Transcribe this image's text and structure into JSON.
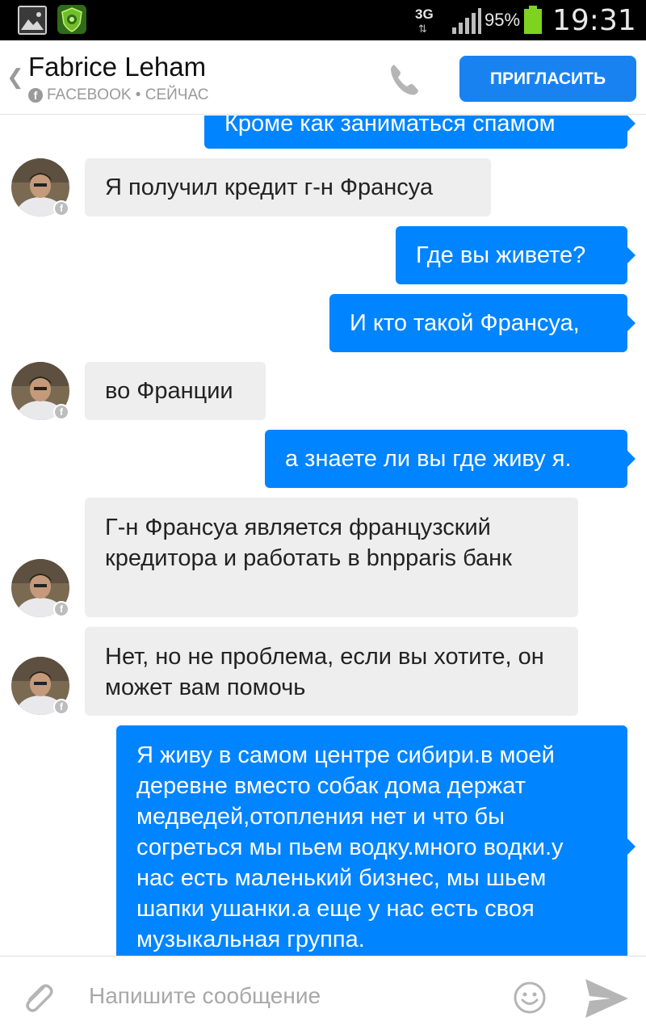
{
  "status_bar": {
    "network": "3G",
    "battery_percent": "95%",
    "time": "19:31"
  },
  "header": {
    "contact_name": "Fabrice Leham",
    "source": "FACEBOOK • СЕЙЧАС",
    "invite_label": "ПРИГЛАСИТЬ"
  },
  "messages": [
    {
      "direction": "out",
      "text": "Кроме как заниматься спамом"
    },
    {
      "direction": "in",
      "text": "Я получил кредит г-н Франсуа"
    },
    {
      "direction": "out",
      "text": "Где вы живете?"
    },
    {
      "direction": "out",
      "text": "И кто такой Франсуа,"
    },
    {
      "direction": "in",
      "text": "во Франции"
    },
    {
      "direction": "out",
      "text": "а знаете ли вы где живу я."
    },
    {
      "direction": "in",
      "text": "Г-н Франсуа является французский кредитора и работать в bnpparis банк"
    },
    {
      "direction": "in",
      "text": "Нет, но не проблема, если вы хотите, он может вам помочь"
    },
    {
      "direction": "out",
      "text": "Я живу в самом центре сибири.в моей деревне вместо собак дома держат медведей,отопления нет и что бы согреться мы пьем водку.много водки.у нас есть маленький бизнес, мы шьем шапки ушанки.а еще у нас есть своя музыкальная группа."
    }
  ],
  "composer": {
    "placeholder": "Напишите сообщение"
  },
  "icons": {
    "status_left": [
      "gallery-icon",
      "shield-app-icon"
    ],
    "header": [
      "back-chevron-icon",
      "facebook-icon",
      "phone-icon"
    ],
    "composer": [
      "paperclip-icon",
      "emoji-icon",
      "send-icon"
    ]
  },
  "colors": {
    "accent": "#0084ff",
    "invite_button": "#1883f0",
    "incoming_bubble": "#eeeeee",
    "battery": "#7ed321"
  }
}
